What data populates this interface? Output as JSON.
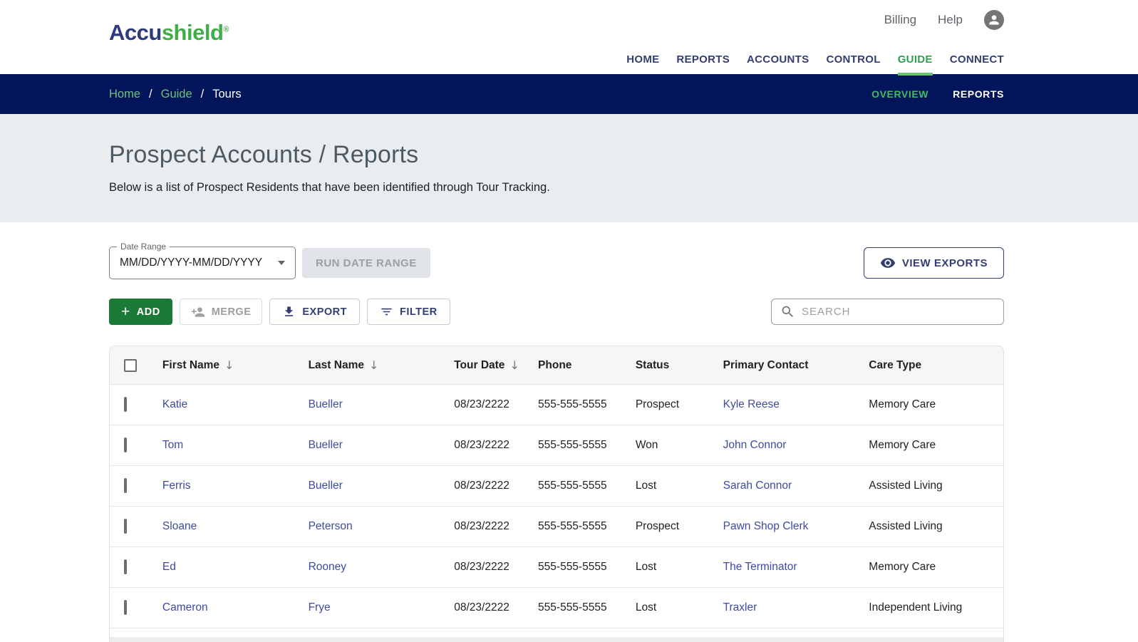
{
  "header": {
    "logo": {
      "part1": "Accu",
      "part2": "shield",
      "registered": "®"
    },
    "utility": {
      "billing": "Billing",
      "help": "Help"
    },
    "nav": [
      {
        "label": "HOME"
      },
      {
        "label": "REPORTS"
      },
      {
        "label": "ACCOUNTS"
      },
      {
        "label": "CONTROL"
      },
      {
        "label": "GUIDE"
      },
      {
        "label": "CONNECT"
      }
    ],
    "active_nav": "GUIDE"
  },
  "breadcrumb_bar": {
    "crumbs": [
      {
        "label": "Home"
      },
      {
        "label": "Guide"
      },
      {
        "label": "Tours"
      }
    ],
    "separator": "/",
    "tabs": [
      {
        "label": "OVERVIEW"
      },
      {
        "label": "REPORTS"
      }
    ],
    "active_tab": "OVERVIEW"
  },
  "page_header": {
    "title": "Prospect Accounts / Reports",
    "subtitle": "Below is a list of Prospect Residents that have been identified through Tour Tracking."
  },
  "toolbar": {
    "date_range": {
      "label": "Date Range",
      "value": "MM/DD/YYYY-MM/DD/YYYY"
    },
    "run_date_range_label": "RUN DATE RANGE",
    "view_exports_label": "VIEW EXPORTS",
    "add_label": "ADD",
    "merge_label": "MERGE",
    "export_label": "EXPORT",
    "filter_label": "FILTER",
    "search_placeholder": "SEARCH"
  },
  "table": {
    "columns": [
      {
        "label": "First Name",
        "sortable": true
      },
      {
        "label": "Last Name",
        "sortable": true
      },
      {
        "label": "Tour Date",
        "sortable": true
      },
      {
        "label": "Phone",
        "sortable": false
      },
      {
        "label": "Status",
        "sortable": false
      },
      {
        "label": "Primary Contact",
        "sortable": false
      },
      {
        "label": "Care Type",
        "sortable": false
      }
    ],
    "rows": [
      {
        "first_name": "Katie",
        "last_name": "Bueller",
        "tour_date": "08/23/2222",
        "phone": "555-555-5555",
        "status": "Prospect",
        "primary_contact": "Kyle Reese",
        "care_type": "Memory Care"
      },
      {
        "first_name": "Tom",
        "last_name": "Bueller",
        "tour_date": "08/23/2222",
        "phone": "555-555-5555",
        "status": "Won",
        "primary_contact": "John Connor",
        "care_type": "Memory Care"
      },
      {
        "first_name": "Ferris",
        "last_name": "Bueller",
        "tour_date": "08/23/2222",
        "phone": "555-555-5555",
        "status": "Lost",
        "primary_contact": "Sarah Connor",
        "care_type": "Assisted Living"
      },
      {
        "first_name": "Sloane",
        "last_name": "Peterson",
        "tour_date": "08/23/2222",
        "phone": "555-555-5555",
        "status": "Prospect",
        "primary_contact": "Pawn Shop Clerk",
        "care_type": "Assisted Living"
      },
      {
        "first_name": "Ed",
        "last_name": "Rooney",
        "tour_date": "08/23/2222",
        "phone": "555-555-5555",
        "status": "Lost",
        "primary_contact": "The Terminator",
        "care_type": "Memory Care"
      },
      {
        "first_name": "Cameron",
        "last_name": "Frye",
        "tour_date": "08/23/2222",
        "phone": "555-555-5555",
        "status": "Lost",
        "primary_contact": "Traxler",
        "care_type": "Independent Living"
      }
    ]
  },
  "icons": {
    "account_circle": "person-in-gray-circle",
    "dropdown_caret": "▾",
    "add": "+",
    "merge": "person-add-glyph",
    "export": "download-arrow-with-bar",
    "filter": "filter-list-lines",
    "view": "eye-glyph",
    "search": "magnifier-glyph",
    "sort": "↓",
    "checkbox": "empty-square-outline"
  },
  "colors": {
    "navy_bar": "#02145a",
    "nav_text": "#333d72",
    "brand_green": "#3fae49",
    "active_green": "#2e9e4f",
    "underline_green": "#62c573",
    "breadcrumb_green": "#6dc27e",
    "link_indigo": "#3e4b9e",
    "add_button_green": "#1b7a35",
    "title_band_bg": "#e9edf0",
    "title_text": "#4d5a64"
  }
}
